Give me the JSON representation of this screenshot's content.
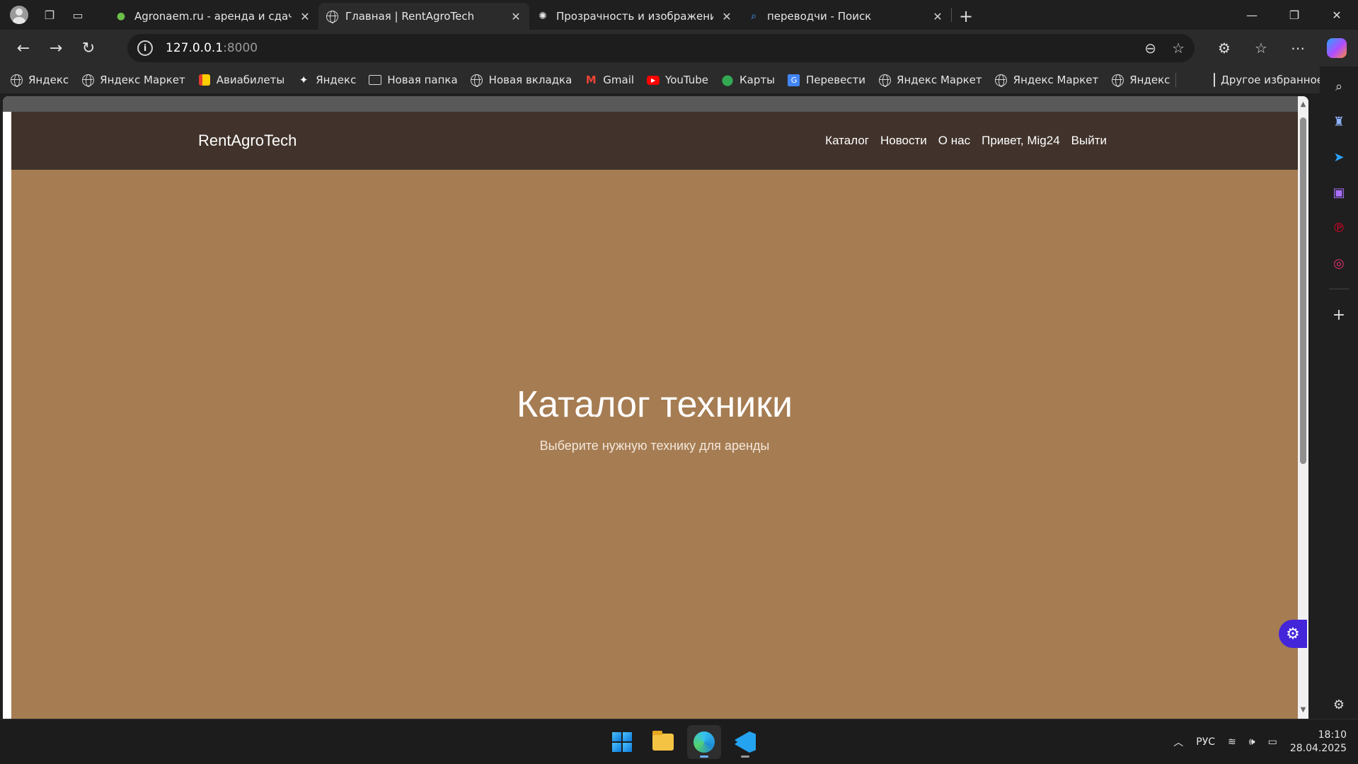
{
  "browser": {
    "tabs": [
      {
        "title": "Agronaem.ru - аренда и сдача в",
        "favicon": "leaf-icon",
        "active": false
      },
      {
        "title": "Главная | RentAgroTech",
        "favicon": "globe-icon",
        "active": true
      },
      {
        "title": "Прозрачность и изображение ф",
        "favicon": "openai-icon",
        "active": false
      },
      {
        "title": "переводчи - Поиск",
        "favicon": "search-icon",
        "active": false
      }
    ],
    "address": {
      "host": "127.0.0.1",
      "port": ":8000"
    },
    "bookmarks": [
      {
        "label": "Яндекс",
        "icon": "globe-icon"
      },
      {
        "label": "Яндекс Маркет",
        "icon": "globe-icon"
      },
      {
        "label": "Авиабилеты",
        "icon": "plane-tickets-icon"
      },
      {
        "label": "Яндекс",
        "icon": "star-sparkle-icon"
      },
      {
        "label": "Новая папка",
        "icon": "folder-icon"
      },
      {
        "label": "Новая вкладка",
        "icon": "globe-icon"
      },
      {
        "label": "Gmail",
        "icon": "gmail-icon"
      },
      {
        "label": "YouTube",
        "icon": "youtube-icon"
      },
      {
        "label": "Карты",
        "icon": "maps-pin-icon"
      },
      {
        "label": "Перевести",
        "icon": "translate-icon"
      },
      {
        "label": "Яндекс Маркет",
        "icon": "globe-icon"
      },
      {
        "label": "Яндекс Маркет",
        "icon": "globe-icon"
      },
      {
        "label": "Яндекс",
        "icon": "globe-icon"
      }
    ],
    "other_favorites": "Другое избранное"
  },
  "site": {
    "brand": "RentAgroTech",
    "nav": [
      "Каталог",
      "Новости",
      "О нас",
      "Привет, Mig24",
      "Выйти"
    ],
    "hero_title": "Каталог техники",
    "hero_subtitle": "Выберите нужную технику для аренды",
    "colors": {
      "header": "#41332b",
      "hero": "#a67c52",
      "floating_button": "#4326d9"
    }
  },
  "taskbar": {
    "language": "РУС",
    "time": "18:10",
    "date": "28.04.2025"
  }
}
